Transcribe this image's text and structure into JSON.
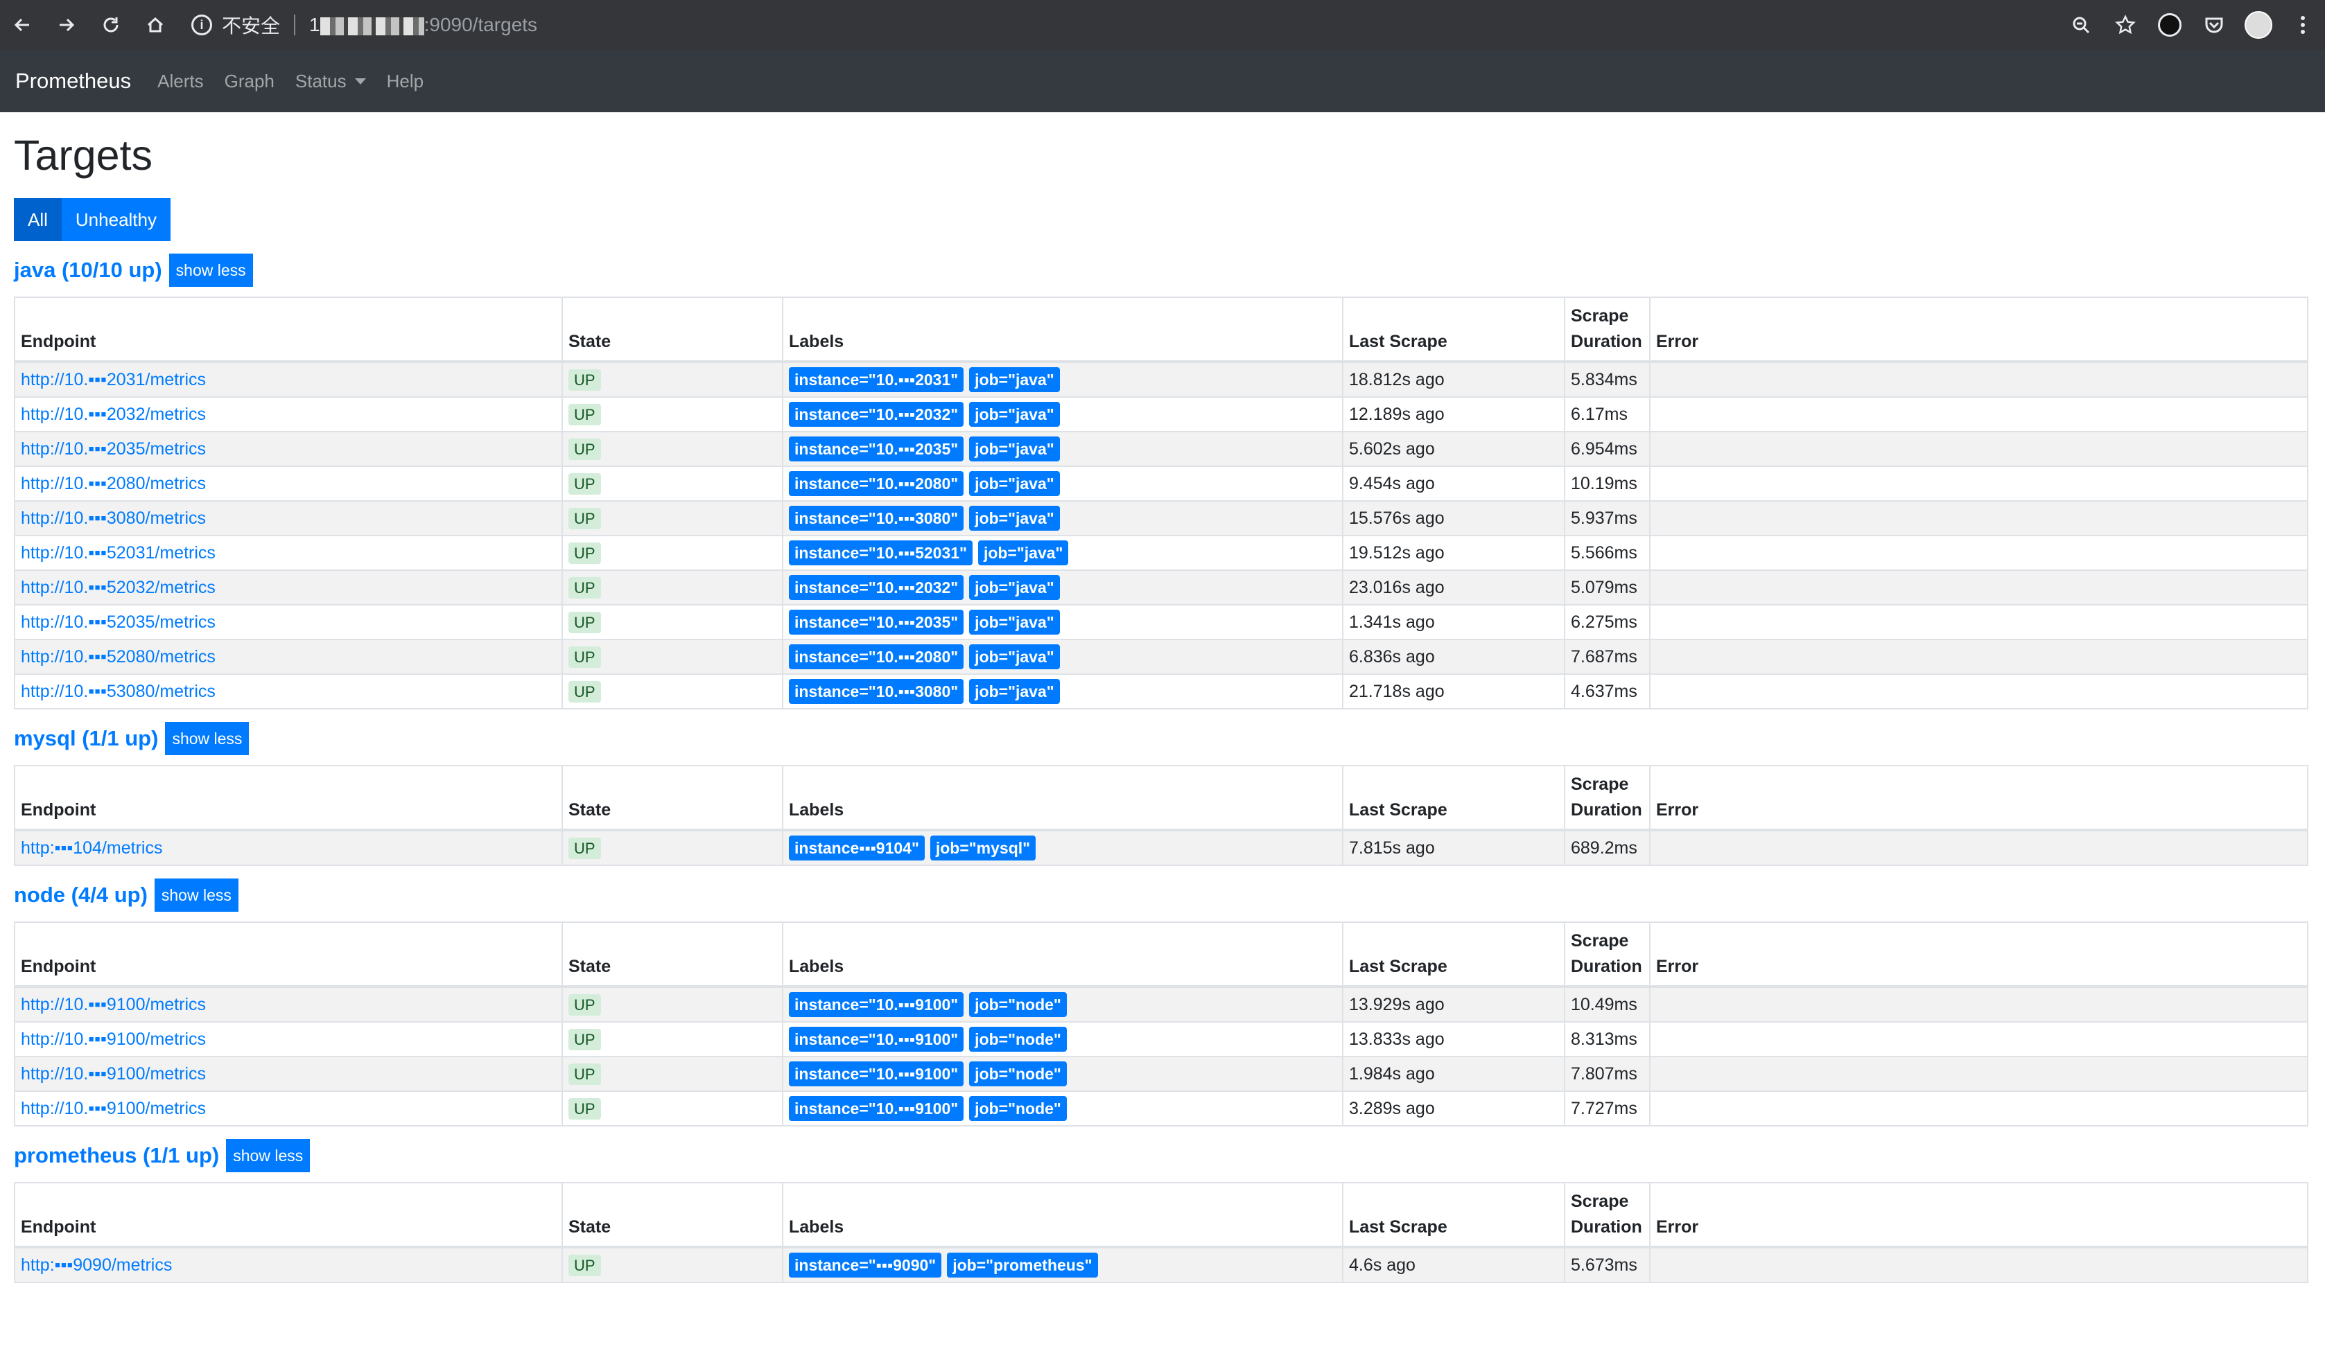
{
  "browser": {
    "security_label": "不安全",
    "host_visible": "1",
    "url_path": ":9090/targets"
  },
  "navbar": {
    "brand": "Prometheus",
    "links": [
      "Alerts",
      "Graph",
      "Status",
      "Help"
    ]
  },
  "page": {
    "title": "Targets",
    "filter_all": "All",
    "filter_unhealthy": "Unhealthy"
  },
  "table_headers": {
    "endpoint": "Endpoint",
    "state": "State",
    "labels": "Labels",
    "last_scrape": "Last Scrape",
    "scrape_duration": "Scrape Duration",
    "error": "Error"
  },
  "show_less_label": "show less",
  "jobs": [
    {
      "title": "java (10/10 up)",
      "rows": [
        {
          "endpoint": "http://10.▪︎▪︎▪︎2031/metrics",
          "state": "UP",
          "instance": "instance=\"10.▪︎▪︎▪︎2031\"",
          "job": "job=\"java\"",
          "last": "18.812s ago",
          "dur": "5.834ms"
        },
        {
          "endpoint": "http://10.▪︎▪︎▪︎2032/metrics",
          "state": "UP",
          "instance": "instance=\"10.▪︎▪︎▪︎2032\"",
          "job": "job=\"java\"",
          "last": "12.189s ago",
          "dur": "6.17ms"
        },
        {
          "endpoint": "http://10.▪︎▪︎▪︎2035/metrics",
          "state": "UP",
          "instance": "instance=\"10.▪︎▪︎▪︎2035\"",
          "job": "job=\"java\"",
          "last": "5.602s ago",
          "dur": "6.954ms"
        },
        {
          "endpoint": "http://10.▪︎▪︎▪︎2080/metrics",
          "state": "UP",
          "instance": "instance=\"10.▪︎▪︎▪︎2080\"",
          "job": "job=\"java\"",
          "last": "9.454s ago",
          "dur": "10.19ms"
        },
        {
          "endpoint": "http://10.▪︎▪︎▪︎3080/metrics",
          "state": "UP",
          "instance": "instance=\"10.▪︎▪︎▪︎3080\"",
          "job": "job=\"java\"",
          "last": "15.576s ago",
          "dur": "5.937ms"
        },
        {
          "endpoint": "http://10.▪︎▪︎▪︎52031/metrics",
          "state": "UP",
          "instance": "instance=\"10.▪︎▪︎▪︎52031\"",
          "job": "job=\"java\"",
          "last": "19.512s ago",
          "dur": "5.566ms"
        },
        {
          "endpoint": "http://10.▪︎▪︎▪︎52032/metrics",
          "state": "UP",
          "instance": "instance=\"10.▪︎▪︎▪︎2032\"",
          "job": "job=\"java\"",
          "last": "23.016s ago",
          "dur": "5.079ms"
        },
        {
          "endpoint": "http://10.▪︎▪︎▪︎52035/metrics",
          "state": "UP",
          "instance": "instance=\"10.▪︎▪︎▪︎2035\"",
          "job": "job=\"java\"",
          "last": "1.341s ago",
          "dur": "6.275ms"
        },
        {
          "endpoint": "http://10.▪︎▪︎▪︎52080/metrics",
          "state": "UP",
          "instance": "instance=\"10.▪︎▪︎▪︎2080\"",
          "job": "job=\"java\"",
          "last": "6.836s ago",
          "dur": "7.687ms"
        },
        {
          "endpoint": "http://10.▪︎▪︎▪︎53080/metrics",
          "state": "UP",
          "instance": "instance=\"10.▪︎▪︎▪︎3080\"",
          "job": "job=\"java\"",
          "last": "21.718s ago",
          "dur": "4.637ms"
        }
      ]
    },
    {
      "title": "mysql (1/1 up)",
      "rows": [
        {
          "endpoint": "http:▪︎▪︎▪︎104/metrics",
          "state": "UP",
          "instance": "instance▪︎▪︎▪︎9104\"",
          "job": "job=\"mysql\"",
          "last": "7.815s ago",
          "dur": "689.2ms"
        }
      ]
    },
    {
      "title": "node (4/4 up)",
      "rows": [
        {
          "endpoint": "http://10.▪︎▪︎▪︎9100/metrics",
          "state": "UP",
          "instance": "instance=\"10.▪︎▪︎▪︎9100\"",
          "job": "job=\"node\"",
          "last": "13.929s ago",
          "dur": "10.49ms"
        },
        {
          "endpoint": "http://10.▪︎▪︎▪︎9100/metrics",
          "state": "UP",
          "instance": "instance=\"10.▪︎▪︎▪︎9100\"",
          "job": "job=\"node\"",
          "last": "13.833s ago",
          "dur": "8.313ms"
        },
        {
          "endpoint": "http://10.▪︎▪︎▪︎9100/metrics",
          "state": "UP",
          "instance": "instance=\"10.▪︎▪︎▪︎9100\"",
          "job": "job=\"node\"",
          "last": "1.984s ago",
          "dur": "7.807ms"
        },
        {
          "endpoint": "http://10.▪︎▪︎▪︎9100/metrics",
          "state": "UP",
          "instance": "instance=\"10.▪︎▪︎▪︎9100\"",
          "job": "job=\"node\"",
          "last": "3.289s ago",
          "dur": "7.727ms"
        }
      ]
    },
    {
      "title": "prometheus (1/1 up)",
      "rows": [
        {
          "endpoint": "http:▪︎▪︎▪︎9090/metrics",
          "state": "UP",
          "instance": "instance=\"▪︎▪︎▪︎9090\"",
          "job": "job=\"prometheus\"",
          "last": "4.6s ago",
          "dur": "5.673ms"
        }
      ]
    }
  ]
}
